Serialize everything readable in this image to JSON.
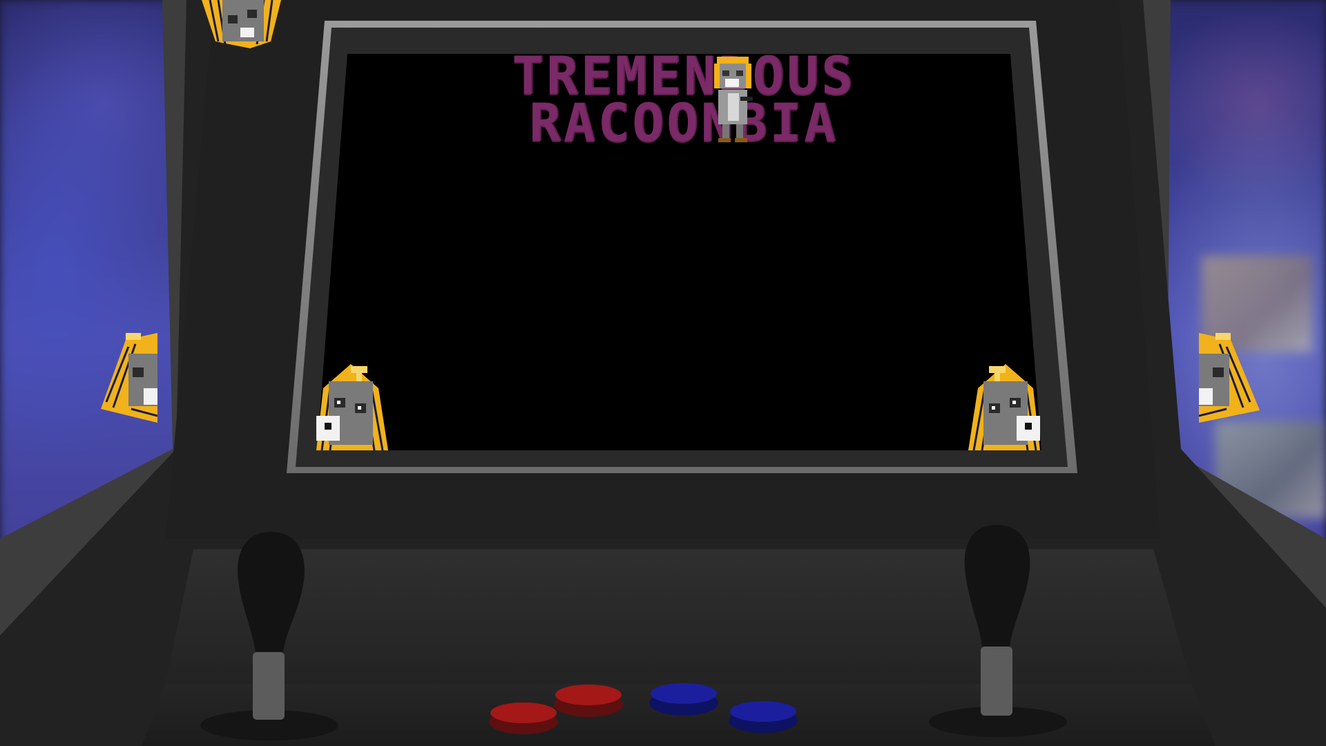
{
  "game": {
    "title_line1": "TREMENDOUS",
    "title_line2": "RACOONBIA"
  },
  "colors": {
    "title": "#7a2a66",
    "cabinet_dark": "#202020",
    "cabinet_panel": "#2c2c2c",
    "screen": "#000000",
    "button_red": "#a41818",
    "button_blue": "#1b1f9e",
    "mascot_gold": "#f1b21b"
  },
  "controls": {
    "joysticks": [
      "left-joystick",
      "right-joystick"
    ],
    "buttons": [
      "red-button-1",
      "red-button-2",
      "blue-button-1",
      "blue-button-2"
    ]
  },
  "sprites": {
    "mascot": "raccoon-pharaoh-icon"
  }
}
